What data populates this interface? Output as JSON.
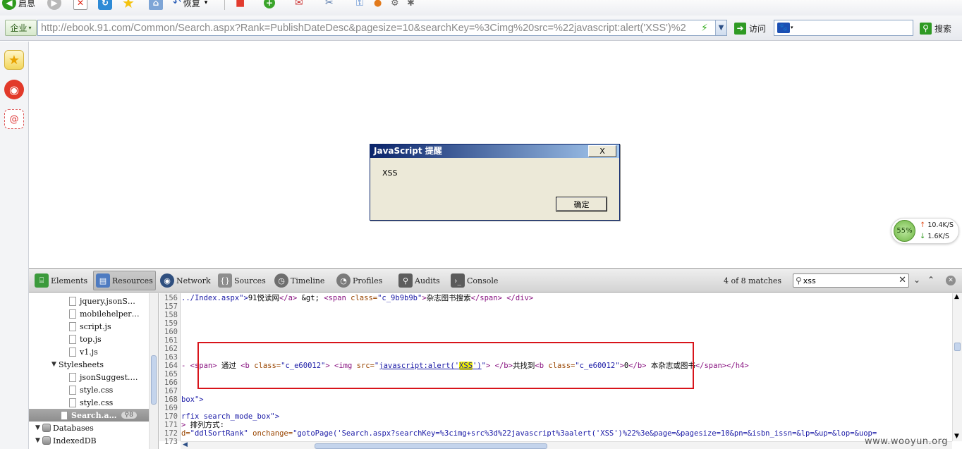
{
  "toolbar": {
    "home_label": "启息",
    "restore_label": "恢复"
  },
  "address_bar": {
    "enterprise_label": "企业",
    "url": "http://ebook.91.com/Common/Search.aspx?Rank=PublishDateDesc&pagesize=10&searchKey=%3Cimg%20src=%22javascript:alert('XSS')%2",
    "visit_label": "访问",
    "search_label": "搜索",
    "search_value": ""
  },
  "dialog": {
    "title": "JavaScript 提醒",
    "message": "XSS",
    "ok_label": "确定",
    "close_label": "X"
  },
  "speed_widget": {
    "percent": "55%",
    "upload": "10.4K/S",
    "download": "1.6K/S"
  },
  "devtools": {
    "tabs": [
      {
        "label": "Elements",
        "icon": "elements-icon",
        "active": false
      },
      {
        "label": "Resources",
        "icon": "resources-icon",
        "active": true
      },
      {
        "label": "Network",
        "icon": "network-icon",
        "active": false
      },
      {
        "label": "Sources",
        "icon": "sources-icon",
        "active": false
      },
      {
        "label": "Timeline",
        "icon": "timeline-icon",
        "active": false
      },
      {
        "label": "Profiles",
        "icon": "profiles-icon",
        "active": false
      },
      {
        "label": "Audits",
        "icon": "audits-icon",
        "active": false
      },
      {
        "label": "Console",
        "icon": "console-icon",
        "active": false
      }
    ],
    "match_count": "4 of 8 matches",
    "search_query": "xss",
    "tree": [
      {
        "label": "jquery.jsonS…",
        "kind": "file"
      },
      {
        "label": "mobilehelper…",
        "kind": "file"
      },
      {
        "label": "script.js",
        "kind": "file"
      },
      {
        "label": "top.js",
        "kind": "file"
      },
      {
        "label": "v1.js",
        "kind": "file"
      },
      {
        "label": "Stylesheets",
        "kind": "folder"
      },
      {
        "label": "jsonSuggest.…",
        "kind": "file"
      },
      {
        "label": "style.css",
        "kind": "file"
      },
      {
        "label": "style.css",
        "kind": "file"
      },
      {
        "label": "Search.a…",
        "kind": "selected",
        "badge": "8"
      },
      {
        "label": "Databases",
        "kind": "db"
      },
      {
        "label": "IndexedDB",
        "kind": "db"
      }
    ],
    "line_numbers": [
      "156",
      "157",
      "158",
      "159",
      "160",
      "161",
      "162",
      "163",
      "164",
      "165",
      "166",
      "167",
      "168",
      "169",
      "170",
      "171",
      "172",
      "173"
    ],
    "code": {
      "l156_a": "../Index.aspx\">",
      "l156_b": "91悦读网",
      "l156_c": "</a>",
      "l156_d": " &gt; ",
      "l156_e": "<span ",
      "l156_f": "class=",
      "l156_g": "\"c_9b9b9b\"",
      "l156_h": ">",
      "l156_i": "杂志图书搜索",
      "l156_j": "</span> </div>",
      "l164_a": "- <span>",
      "l164_b": " 通过 ",
      "l164_c": "<b ",
      "l164_d": "class=",
      "l164_e": "\"c_e60012\"",
      "l164_f": "> <img ",
      "l164_g": "src=",
      "l164_h": "\"",
      "l164_i": "javascript:alert('",
      "l164_j": "XSS",
      "l164_k": "')",
      "l164_l": "\"",
      "l164_m": "> </b>",
      "l164_n": "共找到",
      "l164_o": "<b ",
      "l164_p": "class=",
      "l164_q": "\"c_e60012\"",
      "l164_r": ">",
      "l164_s": "0",
      "l164_t": "</b>",
      "l164_u": " 本杂志或图书",
      "l164_v": "</span></h4>",
      "l168": "box\">",
      "l170": "rfix search_mode_box\">",
      "l171_a": "> ",
      "l171_b": "排列方式:",
      "l172_a": "d=",
      "l172_b": "\"ddlSortRank\"",
      "l172_c": " onchange=",
      "l172_d": "\"gotoPage('Search.aspx?searchKey=%3cimg+src%3d%22javascript%3aalert('XSS')%22%3e&page=&pagesize=10&pn=&isbn_issn=&lp=&up=&lop=&uop="
    }
  },
  "watermark": "www.wooyun.org",
  "colors": {
    "highlight_frame": "#d8141b",
    "dialog_title_start": "#0a246a",
    "find_highlight": "#f2f200"
  }
}
